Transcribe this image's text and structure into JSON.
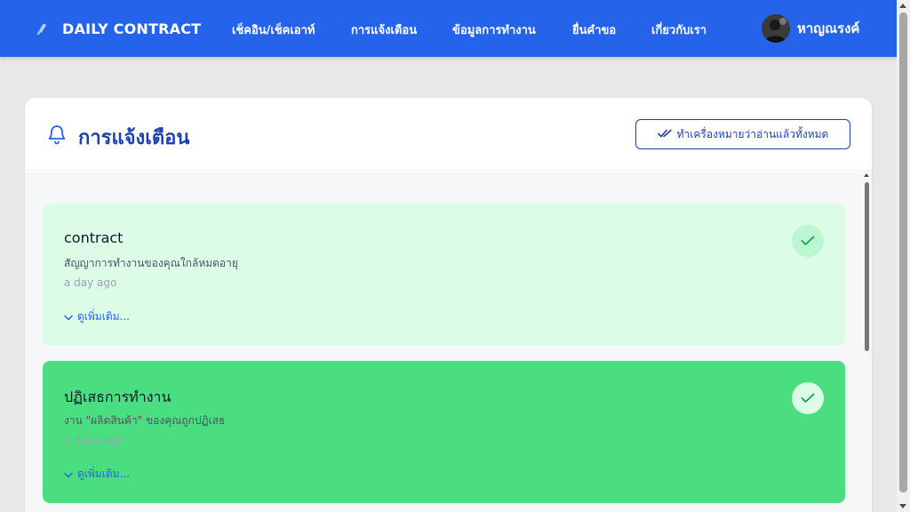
{
  "navbar": {
    "brand": "DAILY CONTRACT",
    "items": [
      {
        "label": "เช็คอิน/เช็คเอาท์"
      },
      {
        "label": "การแจ้งเตือน"
      },
      {
        "label": "ข้อมูลการทำงาน"
      },
      {
        "label": "ยื่นคำขอ"
      },
      {
        "label": "เกี่ยวกับเรา"
      }
    ],
    "user_name": "หาญณรงค์"
  },
  "page": {
    "title": "การแจ้งเตือน",
    "mark_all_read": "ทำเครื่องหมายว่าอ่านแล้วทั้งหมด"
  },
  "notifications": [
    {
      "title": "contract",
      "message": "สัญญาการทำงานของคุณใกล้หมดอายุ",
      "time": "a day ago",
      "more": "ดูเพิ่มเติม..."
    },
    {
      "title": "ปฏิเสธการทำงาน",
      "message": "งาน \"ผลิตสินค้า\" ของคุณถูกปฏิเสธ",
      "time": "2 days ago",
      "more": "ดูเพิ่มเติม..."
    }
  ],
  "icons": {
    "brand": "logo-icon",
    "bell": "bell-icon",
    "double_check": "double-check-icon",
    "chevron": "chevron-down-icon",
    "check": "check-icon"
  },
  "colors": {
    "primary": "#2563eb",
    "title": "#1e40af",
    "notif_read_bg": "#dcfce7",
    "notif_rejected_bg": "#4ade80"
  }
}
